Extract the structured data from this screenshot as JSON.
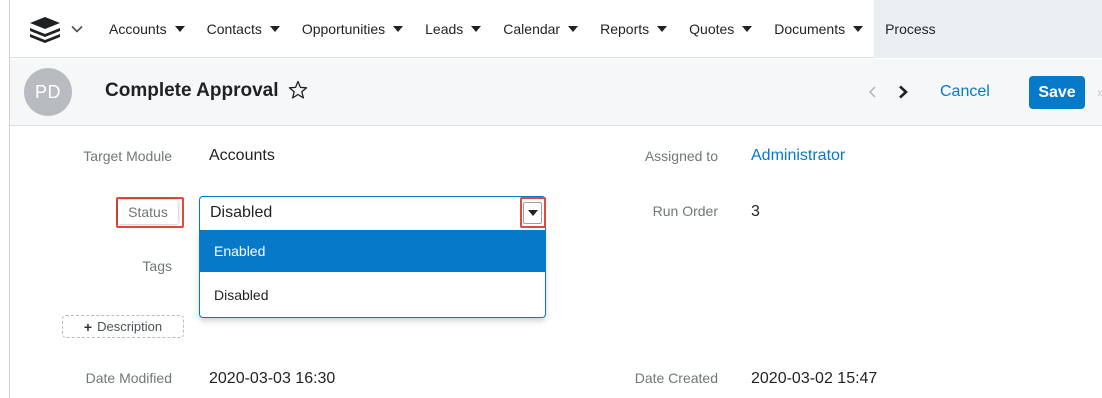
{
  "nav": {
    "items": [
      {
        "label": "Accounts"
      },
      {
        "label": "Contacts"
      },
      {
        "label": "Opportunities"
      },
      {
        "label": "Leads"
      },
      {
        "label": "Calendar"
      },
      {
        "label": "Reports"
      },
      {
        "label": "Quotes"
      },
      {
        "label": "Documents"
      }
    ],
    "partial_item": "Process"
  },
  "header": {
    "avatar_initials": "PD",
    "title": "Complete Approval",
    "cancel_label": "Cancel",
    "save_label": "Save",
    "more_glyph": "»"
  },
  "form": {
    "target_module": {
      "label": "Target Module",
      "value": "Accounts"
    },
    "assigned_to": {
      "label": "Assigned to",
      "value": "Administrator"
    },
    "status": {
      "label": "Status",
      "value": "Disabled",
      "options": [
        "Enabled",
        "Disabled"
      ],
      "highlighted_option": "Enabled"
    },
    "run_order": {
      "label": "Run Order",
      "value": "3"
    },
    "tags": {
      "label": "Tags"
    },
    "description_button": "Description",
    "date_modified": {
      "label": "Date Modified",
      "value": "2020-03-03 16:30"
    },
    "date_created": {
      "label": "Date Created",
      "value": "2020-03-02 15:47"
    }
  },
  "colors": {
    "accent": "#0679c8",
    "highlight_box": "#e04a3a",
    "avatar_bg": "#b8bcc1"
  }
}
